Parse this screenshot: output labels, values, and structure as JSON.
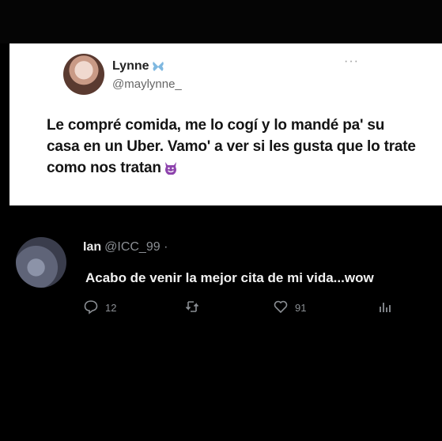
{
  "quoted_tweet": {
    "name": "Lynne",
    "handle": "@maylynne_",
    "text": "Le compré comida, me lo cogí y lo mandé pa' su casa en un Uber. Vamo' a ver si les gusta que lo trate como nos tratan",
    "more_label": "···",
    "icons": [
      "butterfly-icon",
      "devil-emoji-icon"
    ]
  },
  "reply_tweet": {
    "name": "Ian",
    "handle": "@ICC_99 ·",
    "text": "Acabo de venir la mejor cita de mi vida...wow",
    "actions": {
      "reply_count": "12",
      "retweet_count": "",
      "like_count": "91"
    },
    "icons": [
      "reply-icon",
      "retweet-icon",
      "like-icon",
      "analytics-icon"
    ]
  },
  "colors": {
    "background": "#000000",
    "card": "#ffffff",
    "muted": "#8b8f94",
    "devil": "#8e44ad"
  }
}
